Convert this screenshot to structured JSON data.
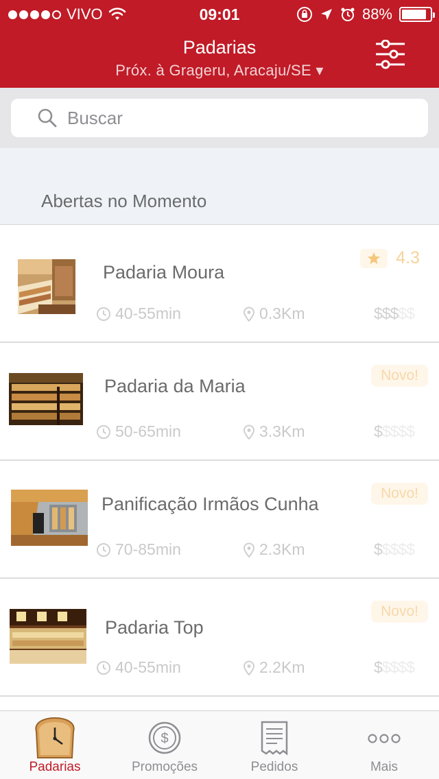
{
  "status_bar": {
    "carrier": "VIVO",
    "time": "09:01",
    "battery": "88%",
    "battery_level": 0.88
  },
  "header": {
    "title": "Padarias",
    "location": "Próx. à Grageru, Aracaju/SE ▾"
  },
  "search": {
    "placeholder": "Buscar"
  },
  "section": {
    "title": "Abertas no Momento"
  },
  "bakeries": [
    {
      "name": "Padaria Moura",
      "time": "40-55min",
      "distance": "0.3Km",
      "price_active": "$$$",
      "price_dim": "$$",
      "rating": "4.3",
      "badge": ""
    },
    {
      "name": "Padaria da Maria",
      "time": "50-65min",
      "distance": "3.3Km",
      "price_active": "$",
      "price_dim": "$$$$",
      "rating": "",
      "badge": "Novo!"
    },
    {
      "name": "Panificação Irmãos Cunha",
      "time": "70-85min",
      "distance": "2.3Km",
      "price_active": "$",
      "price_dim": "$$$$",
      "rating": "",
      "badge": "Novo!"
    },
    {
      "name": "Padaria Top",
      "time": "40-55min",
      "distance": "2.2Km",
      "price_active": "$",
      "price_dim": "$$$$",
      "rating": "",
      "badge": "Novo!"
    }
  ],
  "tabs": [
    {
      "label": "Padarias",
      "icon": "bread-clock-icon",
      "active": true
    },
    {
      "label": "Promoções",
      "icon": "dollar-coin-icon",
      "active": false
    },
    {
      "label": "Pedidos",
      "icon": "receipt-icon",
      "active": false
    },
    {
      "label": "Mais",
      "icon": "more-dots-icon",
      "active": false
    }
  ],
  "colors": {
    "brand_red": "#c01b27",
    "badge_bg": "#fff6ea",
    "badge_text": "#f7d8a8"
  }
}
